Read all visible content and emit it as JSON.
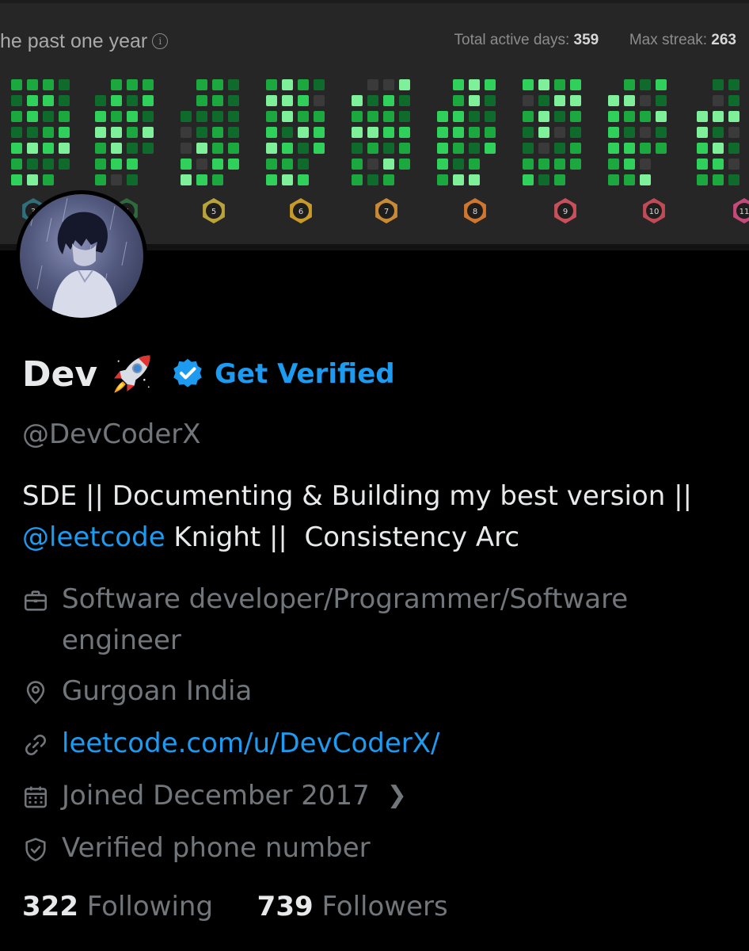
{
  "banner": {
    "heatmap_title": "he past one year",
    "info_icon": "info-icon",
    "stats": [
      {
        "label": "Total active days:",
        "value": "359"
      },
      {
        "label": "Max streak:",
        "value": "263"
      }
    ],
    "badges": [
      "3",
      "4",
      "5",
      "6",
      "7",
      "8",
      "9",
      "10",
      "11"
    ],
    "colors": {
      "background": "#262626",
      "cell_empty": "#3a3a3a",
      "cell_low": "#0e6b2c",
      "cell_mid": "#1aa83f",
      "cell_high": "#2fd15a",
      "cell_max": "#7ef09a"
    }
  },
  "profile": {
    "avatar": "avatar",
    "name": "Dev",
    "name_emoji": "rocket-icon",
    "verified_icon": "verified-badge-icon",
    "get_verified_label": "Get Verified",
    "handle": "@DevCoderX",
    "bio": {
      "line1": "SDE || Documenting & Building my best version ||",
      "mention": "@leetcode",
      "line2_rest": " Knight ||  Consistency Arc"
    },
    "profession": "Software developer/Programmer/Software engineer",
    "location": "Gurgoan India",
    "website": "leetcode.com/u/DevCoderX/",
    "joined": "Joined December 2017",
    "verified_phone": "Verified phone number",
    "following_count": "322",
    "following_label": "Following",
    "followers_count": "739",
    "followers_label": "Followers"
  },
  "colors": {
    "background": "#000000",
    "text_primary": "#e7e9ea",
    "text_secondary": "#71767b",
    "accent_blue": "#1d9bf0"
  }
}
